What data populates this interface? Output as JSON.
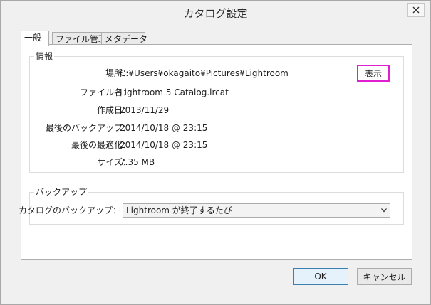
{
  "window": {
    "title": "カタログ設定"
  },
  "tabs": [
    {
      "label": "一般",
      "active": true
    },
    {
      "label": "ファイル管理",
      "active": false
    },
    {
      "label": "メタデータ",
      "active": false
    }
  ],
  "info": {
    "group_label": "情報",
    "location_label": "場所：",
    "location_value": "C:¥Users¥okagaito¥Pictures¥Lightroom",
    "show_button": "表示",
    "filename_label": "ファイル名：",
    "filename_value": "Lightroom 5 Catalog.lrcat",
    "created_label": "作成日：",
    "created_value": "2013/11/29",
    "last_backup_label": "最後のバックアップ：",
    "last_backup_value": "2014/10/18 @ 23:15",
    "last_optimized_label": "最後の最適化：",
    "last_optimized_value": "2014/10/18 @ 23:15",
    "size_label": "サイズ：",
    "size_value": "7.35 MB"
  },
  "backup": {
    "group_label": "バックアップ",
    "catalog_backup_label": "カタログのバックアップ：",
    "catalog_backup_value": "Lightroom が終了するたび"
  },
  "buttons": {
    "ok": "OK",
    "cancel": "キャンセル"
  },
  "colors": {
    "highlight_border": "#e020d0",
    "ok_border": "#3c7fb1"
  },
  "icons": {
    "close": "close-icon",
    "dropdown": "chevron-down-icon"
  }
}
